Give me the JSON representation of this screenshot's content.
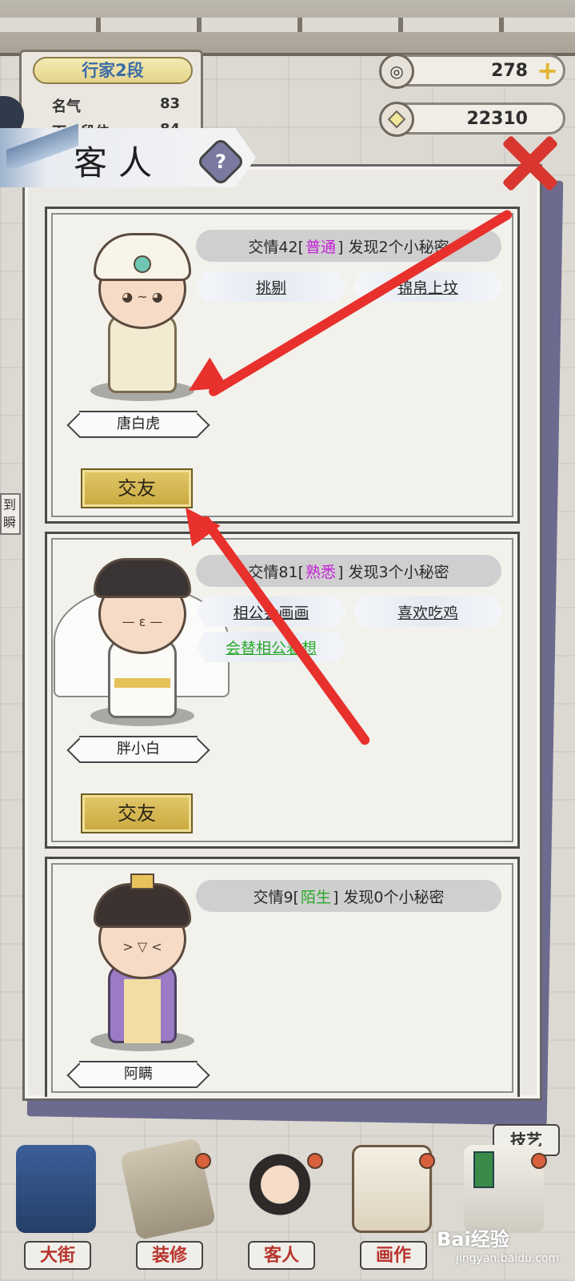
{
  "header": {
    "rank_title": "行家2段",
    "fame_label": "名气",
    "fame_value": "83",
    "next_label": "下一段位",
    "next_value": "84"
  },
  "currency": {
    "jade": "278",
    "coins": "22310"
  },
  "panel": {
    "title": "客人",
    "help_glyph": "?"
  },
  "side_note": "到\n瞬",
  "guests": [
    {
      "name": "唐白虎",
      "relation_prefix": "交情42[",
      "relation_level": "普通",
      "relation_suffix": "] 发现2个小秘密",
      "level_color": "#c21fd6",
      "tags": [
        "挑剔",
        "锦帛上坟"
      ],
      "button": "交友",
      "body_color": "#f3ead2",
      "hat_color": "#f8f4e8"
    },
    {
      "name": "胖小白",
      "relation_prefix": "交情81[",
      "relation_level": "熟悉",
      "relation_suffix": "] 发现3个小秘密",
      "level_color": "#c21fd6",
      "tags": [
        "相公会画画",
        "喜欢吃鸡",
        "会替相公着想"
      ],
      "button": "交友",
      "body_color": "#fbfaf6",
      "hat_color": "#3a3434"
    },
    {
      "name": "阿瞒",
      "relation_prefix": "交情9[",
      "relation_level": "陌生",
      "relation_suffix": "] 发现0个小秘密",
      "level_color": "#2aa82a",
      "tags": [],
      "button": "",
      "body_color": "#9a7bc4",
      "hat_color": "#3c3330"
    }
  ],
  "nav": {
    "street": "大街",
    "decorate": "装修",
    "guests": "客人",
    "paintings": "画作",
    "skills": "技艺"
  },
  "watermark": {
    "main": "Bai经验",
    "sub": "jingyan.baidu.com"
  },
  "colors": {
    "accent_red": "#e8302c",
    "button_gold": "#d4b54f",
    "panel_bg": "#ebe9e3"
  }
}
